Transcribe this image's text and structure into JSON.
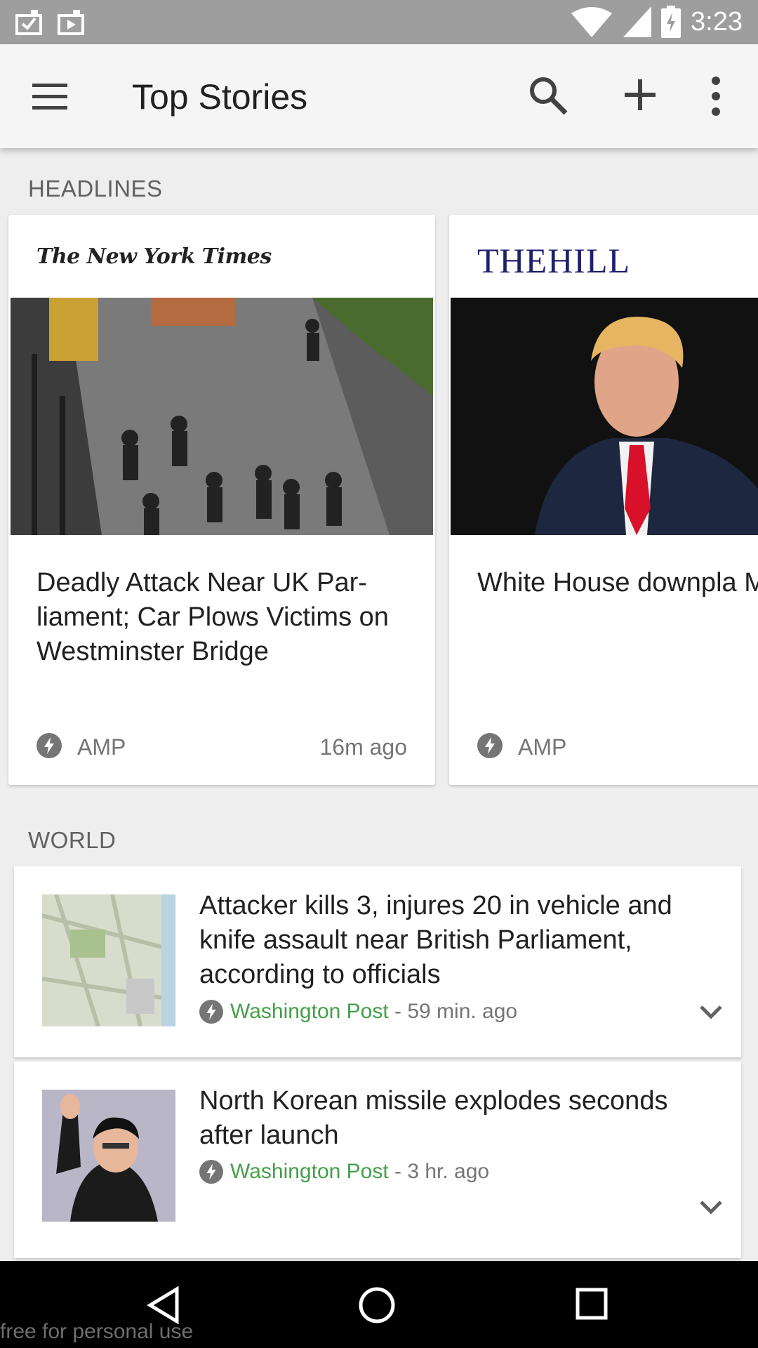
{
  "status_bar": {
    "time": "3:23"
  },
  "app_bar": {
    "title": "Top Stories"
  },
  "headlines": {
    "section_label": "HEADLINES",
    "cards": [
      {
        "source_logo": "The New York Times",
        "headline": "Deadly Attack Near UK Par-liament; Car Plows Victims on Westminster Bridge",
        "amp_label": "AMP",
        "time": "16m ago"
      },
      {
        "source_logo": "THEHILL",
        "headline": "White House downpla Manafort's Russia linl",
        "amp_label": "AMP",
        "time": ""
      }
    ]
  },
  "world": {
    "section_label": "WORLD",
    "items": [
      {
        "title": "Attacker kills 3, injures 20 in vehicle and knife assault near British Parliament, according to officials",
        "source": "Washington Post",
        "time": " - 59 min. ago"
      },
      {
        "title": "North Korean missile explodes seconds after launch",
        "source": "Washington Post",
        "time": " - 3 hr. ago"
      }
    ]
  },
  "watermark": "free for personal use",
  "colors": {
    "source_green": "#43a047",
    "status_bar": "#9e9e9e",
    "app_bar": "#f5f5f5"
  }
}
